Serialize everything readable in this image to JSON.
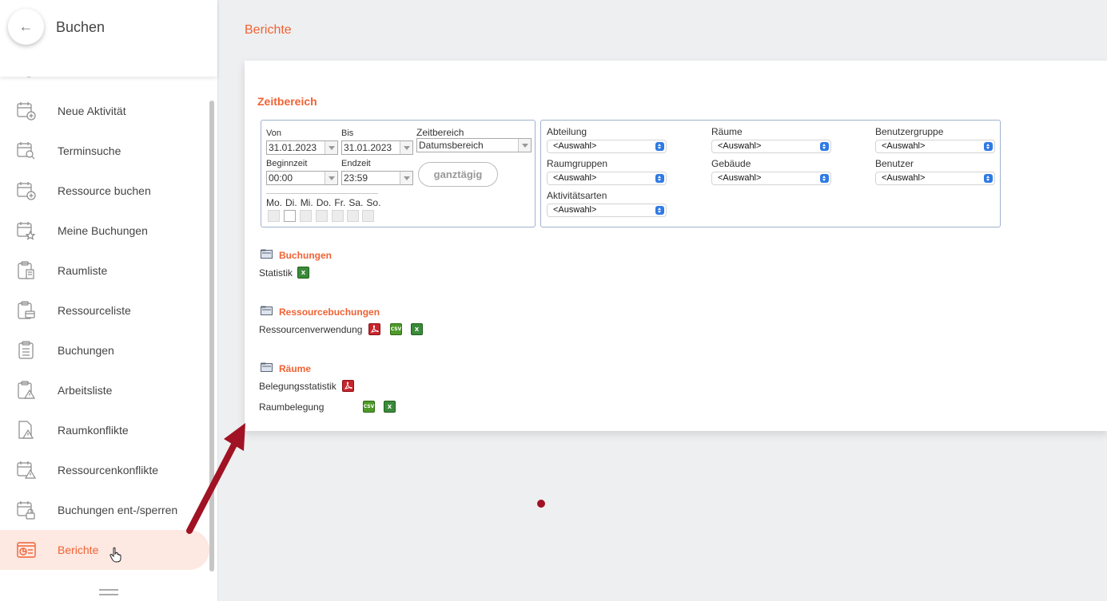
{
  "sidebar": {
    "back_label": "←",
    "title": "Buchen",
    "items": [
      {
        "label": "Neue Aktivität",
        "icon": "calendar-plus-icon"
      },
      {
        "label": "Terminsuche",
        "icon": "calendar-search-icon"
      },
      {
        "label": "Ressource buchen",
        "icon": "calendar-plus-icon"
      },
      {
        "label": "Meine Buchungen",
        "icon": "calendar-star-icon"
      },
      {
        "label": "Raumliste",
        "icon": "clipboard-building-icon"
      },
      {
        "label": "Ressourceliste",
        "icon": "clipboard-box-icon"
      },
      {
        "label": "Buchungen",
        "icon": "clipboard-list-icon"
      },
      {
        "label": "Arbeitsliste",
        "icon": "clipboard-warning-icon"
      },
      {
        "label": "Raumkonflikte",
        "icon": "document-warning-icon"
      },
      {
        "label": "Ressourcenkonflikte",
        "icon": "calendar-warning-icon"
      },
      {
        "label": "Buchungen ent-/sperren",
        "icon": "calendar-lock-icon"
      },
      {
        "label": "Berichte",
        "icon": "report-icon",
        "active": true
      }
    ]
  },
  "main": {
    "page_title": "Berichte",
    "section_title": "Zeitbereich",
    "time": {
      "von_label": "Von",
      "von_value": "31.01.2023",
      "bis_label": "Bis",
      "bis_value": "31.01.2023",
      "range_label": "Zeitbereich",
      "range_value": "Datumsbereich",
      "start_label": "Beginnzeit",
      "start_value": "00:00",
      "end_label": "Endzeit",
      "end_value": "23:59",
      "allday_label": "ganztägig",
      "days": [
        "Mo.",
        "Di.",
        "Mi.",
        "Do.",
        "Fr.",
        "Sa.",
        "So."
      ]
    },
    "filters": {
      "abteilung_label": "Abteilung",
      "raeume_label": "Räume",
      "benutzergruppe_label": "Benutzergruppe",
      "raumgruppen_label": "Raumgruppen",
      "gebaeude_label": "Gebäude",
      "benutzer_label": "Benutzer",
      "aktivitaetsarten_label": "Aktivitätsarten",
      "select_value": "<Auswahl>"
    },
    "reports": {
      "buchungen_title": "Buchungen",
      "statistik_label": "Statistik",
      "ressource_title": "Ressourcebuchungen",
      "ressourcenverwendung_label": "Ressourcenverwendung",
      "raeume_title": "Räume",
      "belegungsstatistik_label": "Belegungsstatistik",
      "raumbelegung_label": "Raumbelegung",
      "csv_text": "CSV",
      "xls_text": "X"
    }
  },
  "colors": {
    "accent": "#f06233",
    "active_bg": "#fde8e2",
    "arrow": "#a01224"
  }
}
